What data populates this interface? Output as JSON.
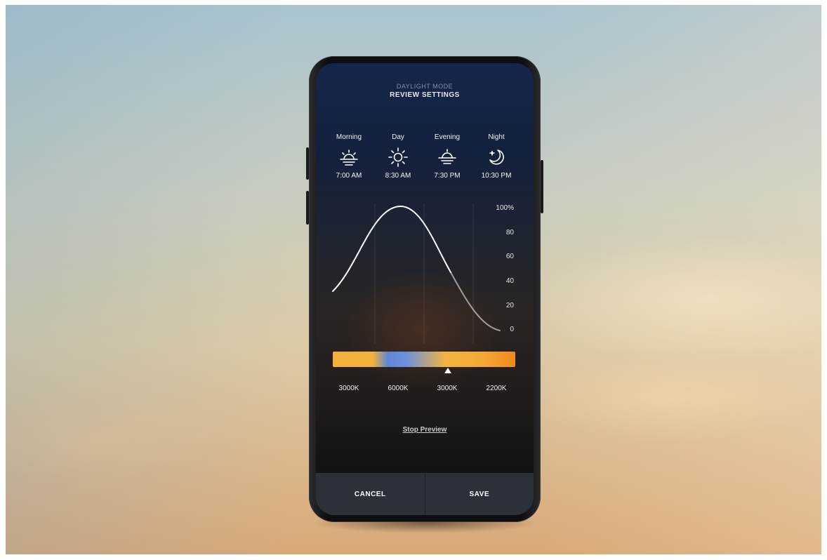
{
  "header": {
    "subtitle": "DAYLIGHT MODE",
    "title": "REVIEW SETTINGS"
  },
  "periods": [
    {
      "label": "Morning",
      "time": "7:00 AM",
      "icon": "sunrise-icon"
    },
    {
      "label": "Day",
      "time": "8:30 AM",
      "icon": "sun-icon"
    },
    {
      "label": "Evening",
      "time": "7:30 PM",
      "icon": "sunset-icon"
    },
    {
      "label": "Night",
      "time": "10:30 PM",
      "icon": "moon-star-icon"
    }
  ],
  "brightness_axis": {
    "ticks": [
      "100%",
      "80",
      "60",
      "40",
      "20",
      "0"
    ]
  },
  "color_temperature": {
    "labels": [
      "3000K",
      "6000K",
      "3000K",
      "2200K"
    ],
    "colors": [
      "#f3b13b",
      "#6a8fdc",
      "#f3b540",
      "#f08a1f"
    ],
    "marker_position_fraction": 0.63
  },
  "stop_preview_label": "Stop Preview",
  "footer": {
    "cancel_label": "CANCEL",
    "save_label": "SAVE"
  }
}
